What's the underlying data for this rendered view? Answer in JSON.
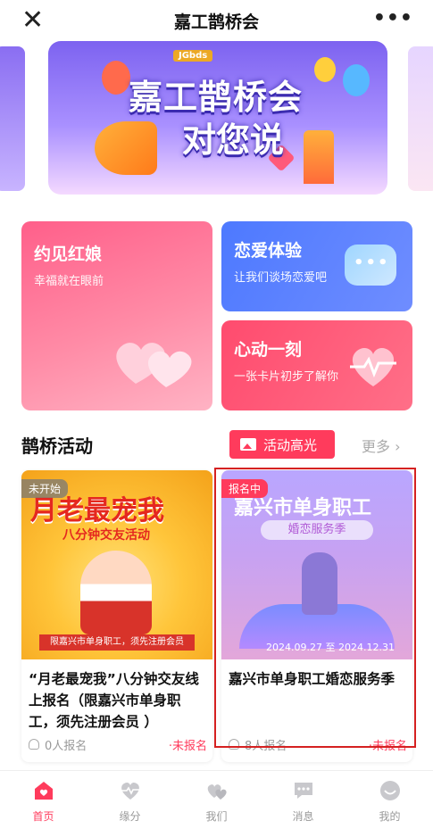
{
  "topbar": {
    "title": "嘉工鹊桥会"
  },
  "banner": {
    "brand": "JGbds",
    "line1": "嘉工鹊桥会",
    "line2": "对您说"
  },
  "features": {
    "hongniang": {
      "title": "约见红娘",
      "subtitle": "幸福就在眼前"
    },
    "lianai": {
      "title": "恋爱体验",
      "subtitle": "让我们谈场恋爱吧"
    },
    "xindong": {
      "title": "心动一刻",
      "subtitle": "一张卡片初步了解你"
    }
  },
  "activities_section": {
    "title": "鹊桥活动",
    "highlight_button": "活动高光",
    "more": "更多 ›"
  },
  "activities": [
    {
      "status": "未开始",
      "poster_title": "月老最宠我",
      "poster_sub": "八分钟交友活动",
      "poster_strip": "限嘉兴市单身职工，须先注册会员",
      "title": "“月老最宠我”八分钟交友线上报名（限嘉兴市单身职工，须先注册会员 ）",
      "count": "0人报名",
      "reg_status": "·未报名"
    },
    {
      "status": "报名中",
      "poster_title": "嘉兴市单身职工",
      "poster_sub": "婚恋服务季",
      "poster_dates": "2024.09.27 至 2024.12.31",
      "title": "嘉兴市单身职工婚恋服务季",
      "count": "8人报名",
      "reg_status": "·未报名"
    }
  ],
  "tabbar": [
    {
      "label": "首页",
      "icon": "home-icon",
      "active": true
    },
    {
      "label": "缘分",
      "icon": "heart-pulse-icon"
    },
    {
      "label": "我们",
      "icon": "hearts-icon"
    },
    {
      "label": "消息",
      "icon": "message-icon"
    },
    {
      "label": "我的",
      "icon": "profile-icon"
    }
  ],
  "colors": {
    "accent": "#ff3b5c",
    "blue": "#4d79ff",
    "pink": "#ff5f8a"
  }
}
